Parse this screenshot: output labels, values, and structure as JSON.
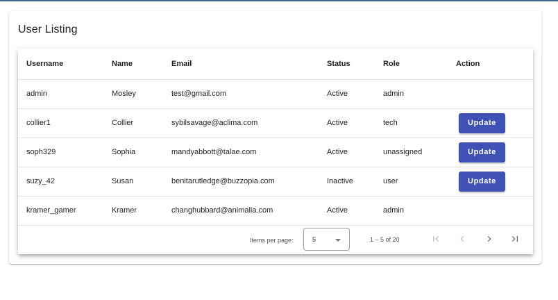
{
  "page": {
    "title": "User Listing"
  },
  "table": {
    "columns": [
      "Username",
      "Name",
      "Email",
      "Status",
      "Role",
      "Action"
    ],
    "rows": [
      {
        "username": "admin",
        "name": "Mosley",
        "email": "test@gmail.com",
        "status": "Active",
        "role": "admin",
        "action": ""
      },
      {
        "username": "collier1",
        "name": "Collier",
        "email": "sybilsavage@aclima.com",
        "status": "Active",
        "role": "tech",
        "action": "Update"
      },
      {
        "username": "soph329",
        "name": "Sophia",
        "email": "mandyabbott@talae.com",
        "status": "Active",
        "role": "unassigned",
        "action": "Update"
      },
      {
        "username": "suzy_42",
        "name": "Susan",
        "email": "benitarutledge@buzzopia.com",
        "status": "Inactive",
        "role": "user",
        "action": "Update"
      },
      {
        "username": "kramer_gamer",
        "name": "Kramer",
        "email": "changhubbard@animalia.com",
        "status": "Active",
        "role": "admin",
        "action": ""
      }
    ]
  },
  "paginator": {
    "items_per_page_label": "Items per page:",
    "page_size": "5",
    "range_label": "1 – 5 of 20",
    "icons": [
      "first-page-icon",
      "previous-page-icon",
      "next-page-icon",
      "last-page-icon"
    ]
  },
  "colors": {
    "primary": "#3f51b5",
    "top_bar": "#3f6a8e"
  }
}
